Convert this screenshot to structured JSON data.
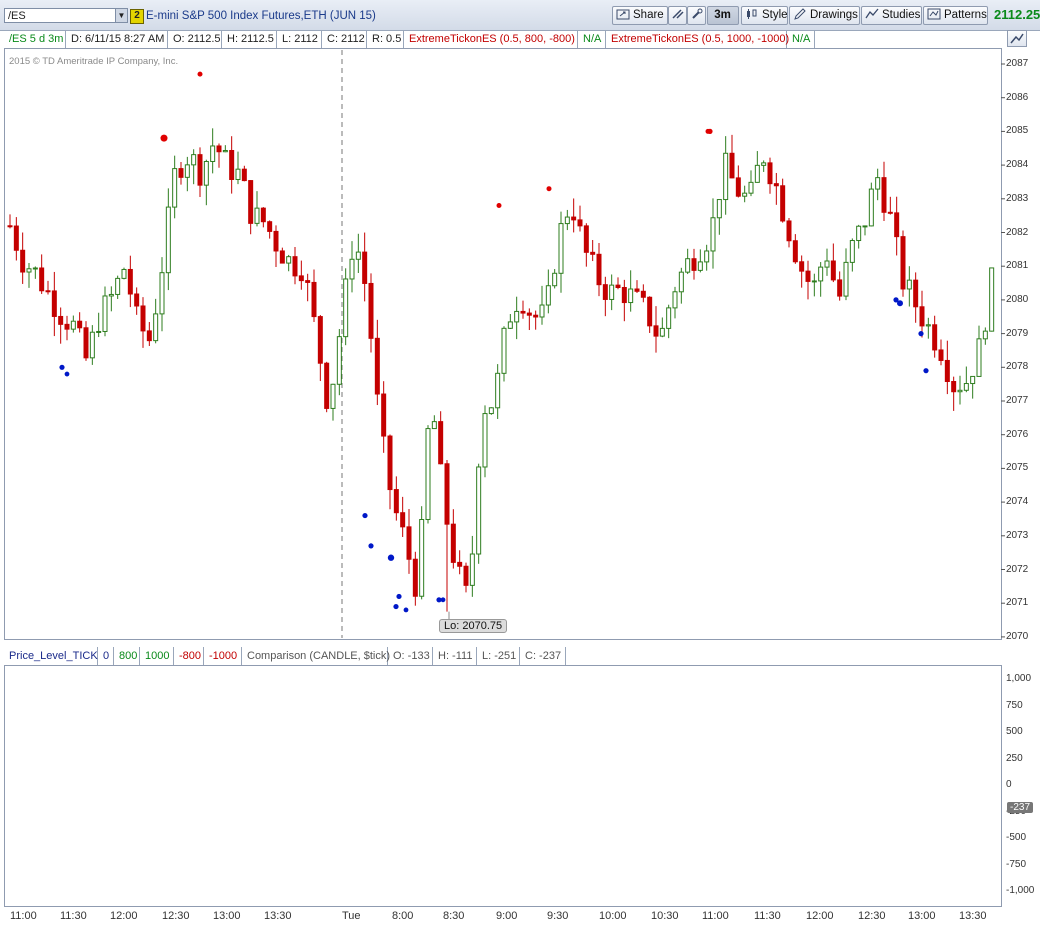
{
  "toolbar": {
    "symbol": "/ES",
    "link_number": "2",
    "description": "E-mini S&P 500 Index Futures,ETH (JUN 15)",
    "share_label": "Share",
    "timeframe_label": "3m",
    "style_label": "Style",
    "drawings_label": "Drawings",
    "studies_label": "Studies",
    "patterns_label": "Patterns",
    "last_price": "2112.25"
  },
  "header": {
    "symbol_period": "/ES 5 d 3m",
    "date": "D: 6/11/15 8:27 AM",
    "open": "O: 2112.5",
    "high": "H: 2112.5",
    "low": "L: 2112",
    "close": "C: 2112",
    "range": "R: 0.5",
    "study1": "ExtremeTickonES (0.5, 800, -800)",
    "study1_val": "N/A",
    "study2": "ExtremeTickonES (0.5, 1000, -1000)",
    "study2_val": "N/A"
  },
  "upper": {
    "copyright": "2015 © TD Ameritrade IP Company, Inc.",
    "y_ticks": [
      "2087",
      "2086",
      "2085",
      "2084",
      "2083",
      "2082",
      "2081",
      "2080",
      "2079",
      "2078",
      "2077",
      "2076",
      "2075",
      "2074",
      "2073",
      "2072",
      "2071",
      "2070"
    ],
    "low_label": "Lo: 2070.75"
  },
  "lower": {
    "study": "Price_Level_TICK",
    "levels": [
      "0",
      "800",
      "1000",
      "-800",
      "-1000"
    ],
    "comparison": "Comparison (CANDLE, $tick)",
    "open": "O: -133",
    "high": "H: -111",
    "low": "L: -251",
    "close": "C: -237",
    "y_ticks": [
      "1,000",
      "750",
      "500",
      "250",
      "0",
      "-250",
      "-500",
      "-750",
      "-1,000"
    ],
    "current_value": "-237"
  },
  "x_axis": [
    "11:00",
    "11:30",
    "12:00",
    "12:30",
    "13:00",
    "13:30",
    "Tue",
    "8:00",
    "8:30",
    "9:00",
    "9:30",
    "10:00",
    "10:30",
    "11:00",
    "11:30",
    "12:00",
    "12:30",
    "13:00",
    "13:30"
  ],
  "colors": {
    "up_candle": "#2e7d1e",
    "down_candle": "#c40000",
    "tick_candle": "#777777",
    "dot_blue": "#0018c8",
    "dot_red": "#e00000",
    "level_green": "#22b022",
    "level_red": "#c00000",
    "zero_line": "#1a2a8a"
  },
  "chart_data": [
    {
      "type": "candlestick",
      "title": "/ES 5 d 3m",
      "ylim": [
        2070,
        2087.5
      ],
      "x_ticks": [
        "11:00",
        "11:30",
        "12:00",
        "12:30",
        "13:00",
        "13:30",
        "Tue",
        "8:00",
        "8:30",
        "9:00",
        "9:30",
        "10:00",
        "10:30",
        "11:00",
        "11:30",
        "12:00",
        "12:30",
        "13:00",
        "13:30"
      ],
      "path_close": [
        2082.2,
        2081.2,
        2080.8,
        2080.2,
        2079.6,
        2079.2,
        2078.2,
        2079.5,
        2080.1,
        2081.0,
        2079.3,
        2078.8,
        2081.2,
        2083.9,
        2084.3,
        2083.8,
        2084.7,
        2084.0,
        2083.7,
        2082.5,
        2082.3,
        2081.6,
        2081.1,
        2081.0,
        2079.0,
        2076.8,
        2079.4,
        2082.0,
        2080.2,
        2076.2,
        2074.0,
        2072.8,
        2071.3,
        2077.3,
        2074.0,
        2072.0,
        2071.0,
        2076.8,
        2077.0,
        2079.4,
        2080.2,
        2079.5,
        2079.5,
        2081.8,
        2083.0,
        2081.5,
        2080.7,
        2080.2,
        2080.3,
        2080.0,
        2079.6,
        2078.8,
        2080.3,
        2081.0,
        2081.5,
        2082.0,
        2084.0,
        2083.3,
        2082.9,
        2084.4,
        2083.5,
        2082.2,
        2081.0,
        2080.3,
        2081.5,
        2080.0,
        2081.5,
        2082.3,
        2083.7,
        2082.5,
        2080.6,
        2079.9,
        2079.2,
        2078.6,
        2077.5,
        2077.6,
        2078.5,
        2080.5
      ],
      "low": 2070.75,
      "extreme_tick_signals_red_prices": [
        2084.8,
        2086.7,
        2082.8,
        2083.3,
        2085.0
      ],
      "extreme_tick_signals_blue_prices": [
        2078.0,
        2073.6,
        2072.7,
        2071.2,
        2070.9,
        2071.1,
        2080.0,
        2079.0,
        2077.9
      ]
    },
    {
      "type": "candlestick",
      "title": "Comparison (CANDLE, $tick)",
      "ylim": [
        -1000,
        1000
      ],
      "levels": [
        1000,
        800,
        0,
        -800,
        -1000
      ],
      "last": -237
    }
  ]
}
